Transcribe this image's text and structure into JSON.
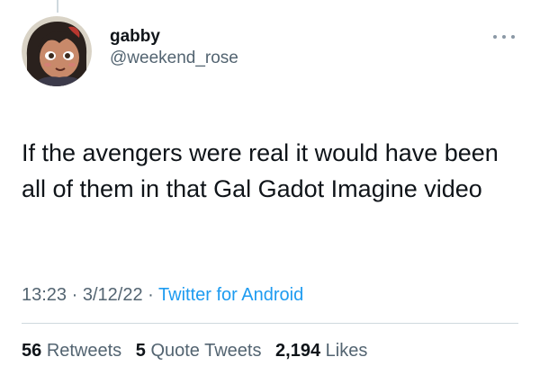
{
  "user": {
    "display_name": "gabby",
    "handle": "@weekend_rose"
  },
  "tweet": {
    "text": "If the avengers were real it would have been all of them in that Gal Gadot Imagine video",
    "time": "13:23",
    "separator": "·",
    "date": "3/12/22",
    "source": "Twitter for Android"
  },
  "stats": {
    "retweets_count": "56",
    "retweets_label": "Retweets",
    "quotes_count": "5",
    "quotes_label": "Quote Tweets",
    "likes_count": "2,194",
    "likes_label": "Likes"
  },
  "icons": {
    "more": "more-options-icon",
    "avatar": "anime-girl-avatar"
  },
  "colors": {
    "text": "#0f1419",
    "secondary": "#536471",
    "link": "#1d9bf0",
    "divider": "#cfd9de"
  }
}
